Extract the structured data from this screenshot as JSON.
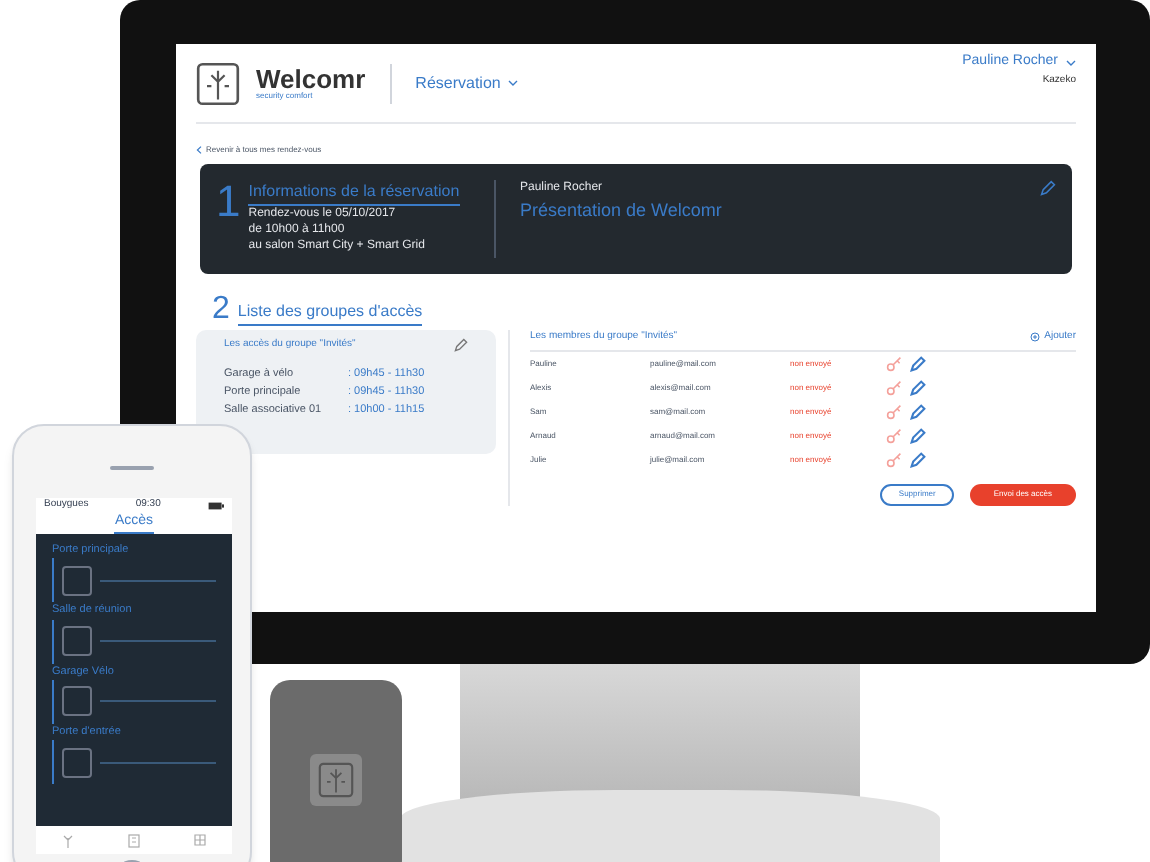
{
  "desktop": {
    "brand": {
      "name": "Welcomr",
      "tagline": "security comfort"
    },
    "nav_menu": "Réservation",
    "user": {
      "name": "Pauline Rocher",
      "company": "Kazeko"
    },
    "back_link": "Revenir à tous mes rendez-vous",
    "reservation": {
      "number": "1",
      "title": "Informations de la réservation",
      "lines": [
        "Rendez-vous le 05/10/2017",
        "de 10h00 à 11h00",
        "au salon Smart City + Smart Grid"
      ],
      "host": "Pauline Rocher",
      "event": "Présentation de Welcomr"
    },
    "groups": {
      "number": "2",
      "title": "Liste des groupes d'accès",
      "group_title": "Les accès du groupe \"Invités\"",
      "access": [
        {
          "place": "Garage à vélo",
          "time": ": 09h45 - 11h30"
        },
        {
          "place": "Porte principale",
          "time": ": 09h45 - 11h30"
        },
        {
          "place": "Salle associative 01",
          "time": ": 10h00 - 11h15"
        }
      ],
      "members_title": "Les membres du groupe \"Invités\"",
      "add": "Ajouter",
      "members": [
        {
          "name": "Pauline",
          "email": "pauline@mail.com",
          "status": "non envoyé"
        },
        {
          "name": "Alexis",
          "email": "alexis@mail.com",
          "status": "non envoyé"
        },
        {
          "name": "Sam",
          "email": "sam@mail.com",
          "status": "non envoyé"
        },
        {
          "name": "Arnaud",
          "email": "arnaud@mail.com",
          "status": "non envoyé"
        },
        {
          "name": "Julie",
          "email": "julie@mail.com",
          "status": "non envoyé"
        }
      ],
      "buttons": [
        "Supprimer",
        "Envoi des accès"
      ]
    }
  },
  "phone": {
    "carrier": "Bouygues",
    "time": "09:30",
    "title": "Accès",
    "doors": [
      {
        "name": "Porte principale"
      },
      {
        "name": "Salle de réunion"
      },
      {
        "name": "Garage Vélo"
      },
      {
        "name": "Porte d'entrée"
      }
    ]
  }
}
